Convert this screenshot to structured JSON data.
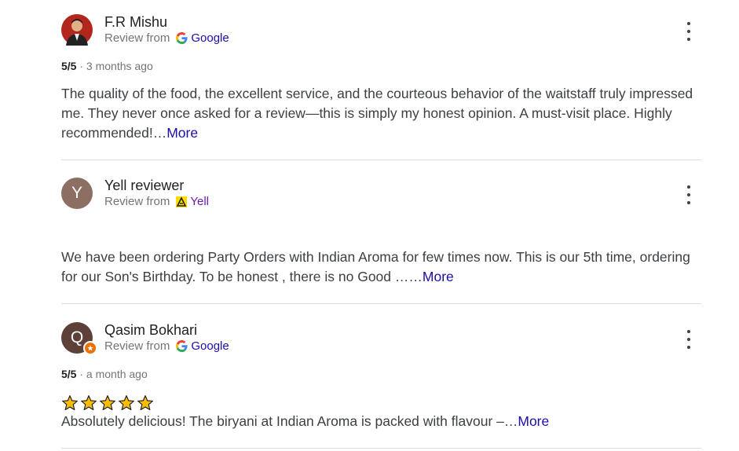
{
  "reviews": [
    {
      "name": "F.R Mishu",
      "review_from": "Review from",
      "source": "Google",
      "source_icon": "google-g-icon",
      "avatar_type": "photo",
      "avatar_color": "#b3261e",
      "rating": "5/5",
      "time": "3 months ago",
      "text": "The quality of the food, the excellent service, and the courteous behavior of the waitstaff truly impressed me. They never once asked for a review—this is simply my honest opinion. A must-visit place. Highly recommended!…",
      "more": "More"
    },
    {
      "name": "Yell reviewer",
      "review_from": "Review from",
      "source": "Yell",
      "source_icon": "yell-logo-icon",
      "avatar_letter": "Y",
      "avatar_color": "#8d6e63",
      "text": "We have been ordering Party Orders with Indian Aroma for few times now. This is our 5th time, ordering for our Son's Birthday. To be honest , there is no Good ……",
      "more": "More"
    },
    {
      "name": "Qasim Bokhari",
      "review_from": "Review from",
      "source": "Google",
      "source_icon": "google-g-icon",
      "avatar_letter": "Q",
      "avatar_color": "#5d4037",
      "badge": "local-guide-badge",
      "rating": "5/5",
      "time": "a month ago",
      "stars": 5,
      "text": "Absolutely delicious! The biryani at Indian Aroma is packed with flavour –…",
      "more": "More"
    }
  ],
  "colors": {
    "link": "#1a0dab",
    "yell_yellow": "#ffdc00",
    "star_fill": "#fbbc04"
  }
}
